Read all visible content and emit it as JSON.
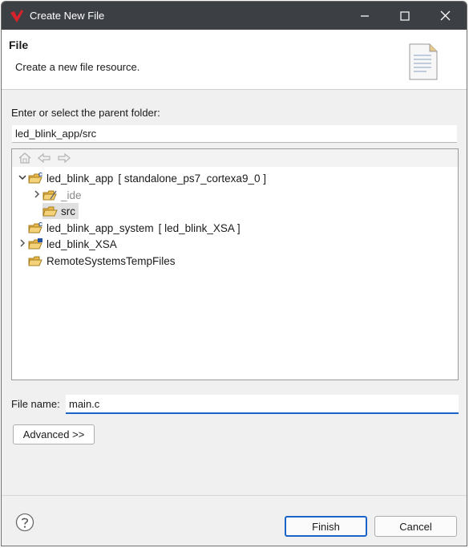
{
  "window": {
    "title": "Create New File"
  },
  "header": {
    "title": "File",
    "description": "Create a new file resource."
  },
  "parent_folder": {
    "label": "Enter or select the parent folder:",
    "value": "led_blink_app/src"
  },
  "tree": {
    "items": [
      {
        "label": "led_blink_app",
        "suffix": "[ standalone_ps7_cortexa9_0 ]",
        "expanded": true
      },
      {
        "label": "_ide",
        "expanded": false
      },
      {
        "label": "src",
        "selected": true
      },
      {
        "label": "led_blink_app_system",
        "suffix": "[ led_blink_XSA ]"
      },
      {
        "label": "led_blink_XSA",
        "expanded": false
      },
      {
        "label": "RemoteSystemsTempFiles"
      }
    ]
  },
  "file_name": {
    "label": "File name:",
    "value": "main.c"
  },
  "buttons": {
    "advanced": "Advanced >>",
    "finish": "Finish",
    "cancel": "Cancel"
  },
  "colors": {
    "titlebar": "#3c3f44",
    "accent": "#1a64c8",
    "folder": "#e8b84a",
    "dialog_bg": "#f0f0f0"
  }
}
